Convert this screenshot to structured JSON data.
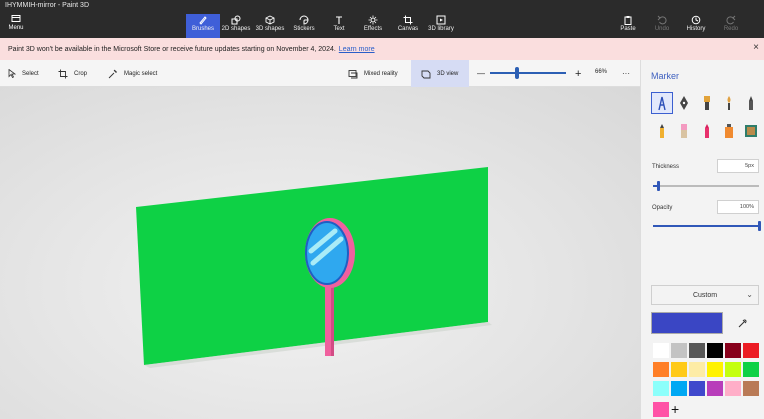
{
  "window": {
    "title": "IHYMMIH-mirror - Paint 3D"
  },
  "toolbar": {
    "menu_label": "Menu",
    "tools": [
      {
        "label": "Brushes",
        "icon": "brush-icon",
        "active": true
      },
      {
        "label": "2D shapes",
        "icon": "2d-shapes-icon"
      },
      {
        "label": "3D shapes",
        "icon": "3d-shapes-icon"
      },
      {
        "label": "Stickers",
        "icon": "stickers-icon"
      },
      {
        "label": "Text",
        "icon": "text-icon"
      },
      {
        "label": "Effects",
        "icon": "effects-icon"
      },
      {
        "label": "Canvas",
        "icon": "canvas-icon"
      },
      {
        "label": "3D library",
        "icon": "3d-library-icon"
      }
    ],
    "right": [
      {
        "label": "Paste",
        "icon": "paste-icon"
      },
      {
        "label": "Undo",
        "icon": "undo-icon",
        "disabled": true
      },
      {
        "label": "History",
        "icon": "history-icon"
      },
      {
        "label": "Redo",
        "icon": "redo-icon",
        "disabled": true
      }
    ]
  },
  "notice": {
    "text": "Paint 3D won't be available in the Microsoft Store or receive future updates starting on November 4, 2024.",
    "link": "Learn more",
    "close": "×"
  },
  "subbar": {
    "select_label": "Select",
    "crop_label": "Crop",
    "magic_select_label": "Magic select",
    "mixed_reality_label": "Mixed reality",
    "view3d_label": "3D view",
    "zoom_out": "—",
    "zoom_in": "+",
    "zoom_value": "66%",
    "zoom_level": 0.35,
    "more": "···"
  },
  "panel": {
    "title": "Marker",
    "brushes": [
      "marker-icon",
      "calligraphy-pen-icon",
      "oil-brush-icon",
      "watercolor-icon",
      "pixel-pen-icon",
      "pencil-icon",
      "eraser-icon",
      "crayon-icon",
      "spray-can-icon",
      "fill-icon"
    ],
    "thickness_label": "Thickness",
    "thickness_value": "5px",
    "thickness_level": 0.05,
    "opacity_label": "Opacity",
    "opacity_value": "100%",
    "opacity_level": 1.0,
    "texture_label": "Custom",
    "current_color": "#3a46c4",
    "palette": [
      "#ffffff",
      "#c3c3c3",
      "#585858",
      "#000000",
      "#88001b",
      "#ec1c24",
      "#ff7f27",
      "#ffca18",
      "#fdeca6",
      "#fff200",
      "#c4ff0e",
      "#0ed145",
      "#8cfffb",
      "#00a8f3",
      "#3f48cc",
      "#b83dba",
      "#ffaec8",
      "#b97a56"
    ],
    "custom_swatch": "#ff52a6",
    "add_color": "+"
  },
  "colors": {
    "accent": "#3f5fd8",
    "canvas_green": "#0ed145",
    "mirror_pink": "#f0609e"
  }
}
